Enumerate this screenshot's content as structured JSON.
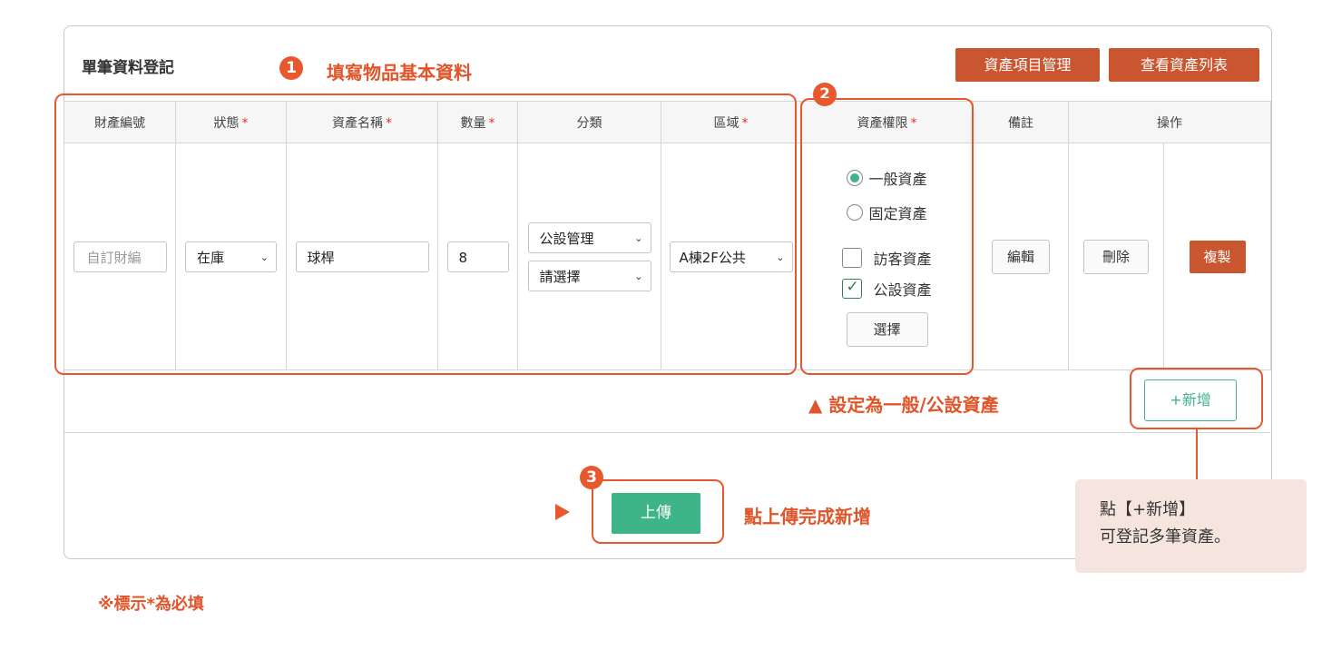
{
  "card": {
    "title": "單筆資料登記",
    "buttons": {
      "manage_items": "資產項目管理",
      "view_list": "查看資產列表"
    }
  },
  "table": {
    "headers": {
      "asset_no": "財產編號",
      "status": "狀態",
      "asset_name": "資產名稱",
      "quantity": "數量",
      "category": "分類",
      "area": "區域",
      "permission": "資產權限",
      "note": "備註",
      "action": "操作"
    },
    "required_mark": "*",
    "row": {
      "asset_no_placeholder": "自訂財編",
      "status_value": "在庫",
      "asset_name_value": "球桿",
      "quantity_value": "8",
      "category_main": "公設管理",
      "category_sub": "請選擇",
      "area_value": "A棟2F公共",
      "permission_radios": [
        {
          "label": "一般資產",
          "checked": true
        },
        {
          "label": "固定資產",
          "checked": false
        }
      ],
      "permission_checks": [
        {
          "label": "訪客資產",
          "checked": false
        },
        {
          "label": "公設資產",
          "checked": true
        }
      ],
      "select_button": "選擇",
      "note_button": "編輯",
      "delete_button": "刪除",
      "copy_button": "複製"
    }
  },
  "add_button": "+新增",
  "upload_button": "上傳",
  "annotations": {
    "step1_number": "1",
    "step1_text": "填寫物品基本資料",
    "step2_number": "2",
    "step2_text": "▲ 設定為一般/公設資產",
    "step3_number": "3",
    "step3_text": "點上傳完成新增",
    "tip_line1": "點【+新增】",
    "tip_line2": "可登記多筆資產。",
    "accent_color": "#e8582f"
  },
  "footnote": "※標示*為必填",
  "colors": {
    "brand": "#c9562f",
    "primary_green": "#3eb489",
    "tip_bg": "#f5e5de"
  }
}
